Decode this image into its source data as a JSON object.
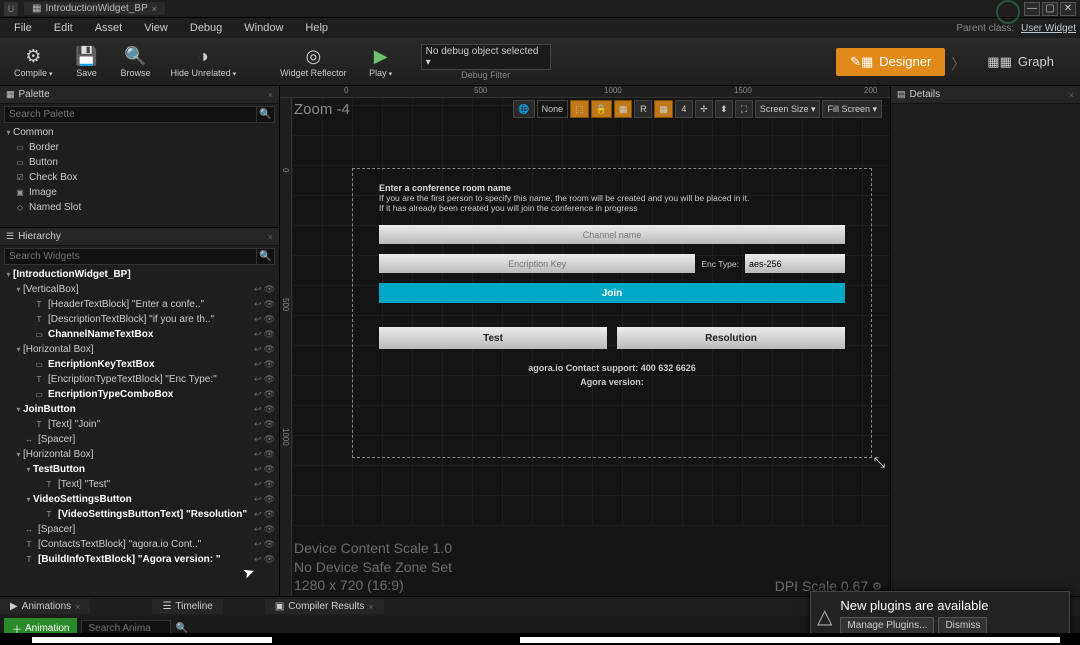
{
  "titlebar": {
    "tab": "IntroductionWidget_BP",
    "tab_suffix": "×"
  },
  "menubar": [
    "File",
    "Edit",
    "Asset",
    "View",
    "Debug",
    "Window",
    "Help"
  ],
  "parent_class": {
    "label": "Parent class:",
    "value": "User Widget"
  },
  "toolbar": {
    "compile": "Compile",
    "save": "Save",
    "browse": "Browse",
    "hide_unrelated": "Hide Unrelated",
    "widget_reflector": "Widget Reflector",
    "play": "Play",
    "debug_select": "No debug object selected ▾",
    "debug_filter": "Debug Filter"
  },
  "modes": {
    "designer": "Designer",
    "graph": "Graph"
  },
  "palette": {
    "tab": "Palette",
    "search_placeholder": "Search Palette",
    "group": "Common",
    "items": [
      "Border",
      "Button",
      "Check Box",
      "Image",
      "Named Slot"
    ]
  },
  "hierarchy": {
    "tab": "Hierarchy",
    "search_placeholder": "Search Widgets",
    "rows": [
      {
        "d": 0,
        "a": "▾",
        "b": true,
        "t": "[IntroductionWidget_BP]",
        "vis": false
      },
      {
        "d": 1,
        "a": "▾",
        "b": false,
        "t": "[VerticalBox]",
        "vis": true
      },
      {
        "d": 2,
        "a": "",
        "b": false,
        "t": "[HeaderTextBlock] \"Enter a confe..\"",
        "vis": true,
        "pre": "T"
      },
      {
        "d": 2,
        "a": "",
        "b": false,
        "t": "[DescriptionTextBlock] \"if you are th..\"",
        "vis": true,
        "pre": "T"
      },
      {
        "d": 2,
        "a": "",
        "b": true,
        "t": "ChannelNameTextBox",
        "vis": true,
        "pre": "▭"
      },
      {
        "d": 1,
        "a": "▾",
        "b": false,
        "t": "[Horizontal Box]",
        "vis": true
      },
      {
        "d": 2,
        "a": "",
        "b": true,
        "t": "EncriptionKeyTextBox",
        "vis": true,
        "pre": "▭"
      },
      {
        "d": 2,
        "a": "",
        "b": false,
        "t": "[EncriptionTypeTextBlock] \"Enc Type:\"",
        "vis": true,
        "pre": "T"
      },
      {
        "d": 2,
        "a": "",
        "b": true,
        "t": "EncriptionTypeComboBox",
        "vis": true,
        "pre": "▭"
      },
      {
        "d": 1,
        "a": "▾",
        "b": true,
        "t": "JoinButton",
        "vis": true
      },
      {
        "d": 2,
        "a": "",
        "b": false,
        "t": "[Text] \"Join\"",
        "vis": true,
        "pre": "T"
      },
      {
        "d": 1,
        "a": "",
        "b": false,
        "t": "[Spacer]",
        "vis": true,
        "pre": "↔"
      },
      {
        "d": 1,
        "a": "▾",
        "b": false,
        "t": "[Horizontal Box]",
        "vis": true
      },
      {
        "d": 2,
        "a": "▾",
        "b": true,
        "t": "TestButton",
        "vis": true
      },
      {
        "d": 3,
        "a": "",
        "b": false,
        "t": "[Text] \"Test\"",
        "vis": true,
        "pre": "T"
      },
      {
        "d": 2,
        "a": "▾",
        "b": true,
        "t": "VideoSettingsButton",
        "vis": true
      },
      {
        "d": 3,
        "a": "",
        "b": true,
        "t": "[VideoSettingsButtonText] \"Resolution\"",
        "vis": true,
        "pre": "T"
      },
      {
        "d": 1,
        "a": "",
        "b": false,
        "t": "[Spacer]",
        "vis": true,
        "pre": "↔"
      },
      {
        "d": 1,
        "a": "",
        "b": false,
        "t": "[ContactsTextBlock] \"agora.io Cont..\"",
        "vis": true,
        "pre": "T"
      },
      {
        "d": 1,
        "a": "",
        "b": true,
        "t": "[BuildInfoTextBlock] \"Agora version: \"",
        "vis": true,
        "pre": "T"
      }
    ]
  },
  "viewport": {
    "zoom": "Zoom -4",
    "none": "None",
    "r": "R",
    "num": "4",
    "screen_size": "Screen Size ▾",
    "fill_screen": "Fill Screen ▾",
    "ruler_h": [
      "0",
      "500",
      "1000",
      "1500",
      "200"
    ],
    "status_lines": [
      "Device Content Scale 1.0",
      "No Device Safe Zone Set",
      "1280 x 720 (16:9)"
    ],
    "dpi": "DPI Scale 0.67"
  },
  "widget": {
    "header": "Enter a conference room name",
    "desc1": "If you are the first person to specify this name, the room will be created and you will be placed in it.",
    "desc2": "If it has already been created you will join the conference in progress",
    "channel_ph": "Channel name",
    "enc_key_ph": "Encription Key",
    "enc_type_label": "Enc Type:",
    "enc_type_value": "aes-256",
    "join": "Join",
    "test": "Test",
    "resolution": "Resolution",
    "contacts": "agora.io Contact support: 400 632 6626",
    "build": "Agora version:"
  },
  "details": {
    "tab": "Details"
  },
  "bottom": {
    "animations": "Animations",
    "timeline": "Timeline",
    "compiler": "Compiler Results",
    "add_anim": "Animation",
    "anim_search_placeholder": "Search Anima"
  },
  "notif": {
    "title": "New plugins are available",
    "manage": "Manage Plugins...",
    "dismiss": "Dismiss"
  }
}
